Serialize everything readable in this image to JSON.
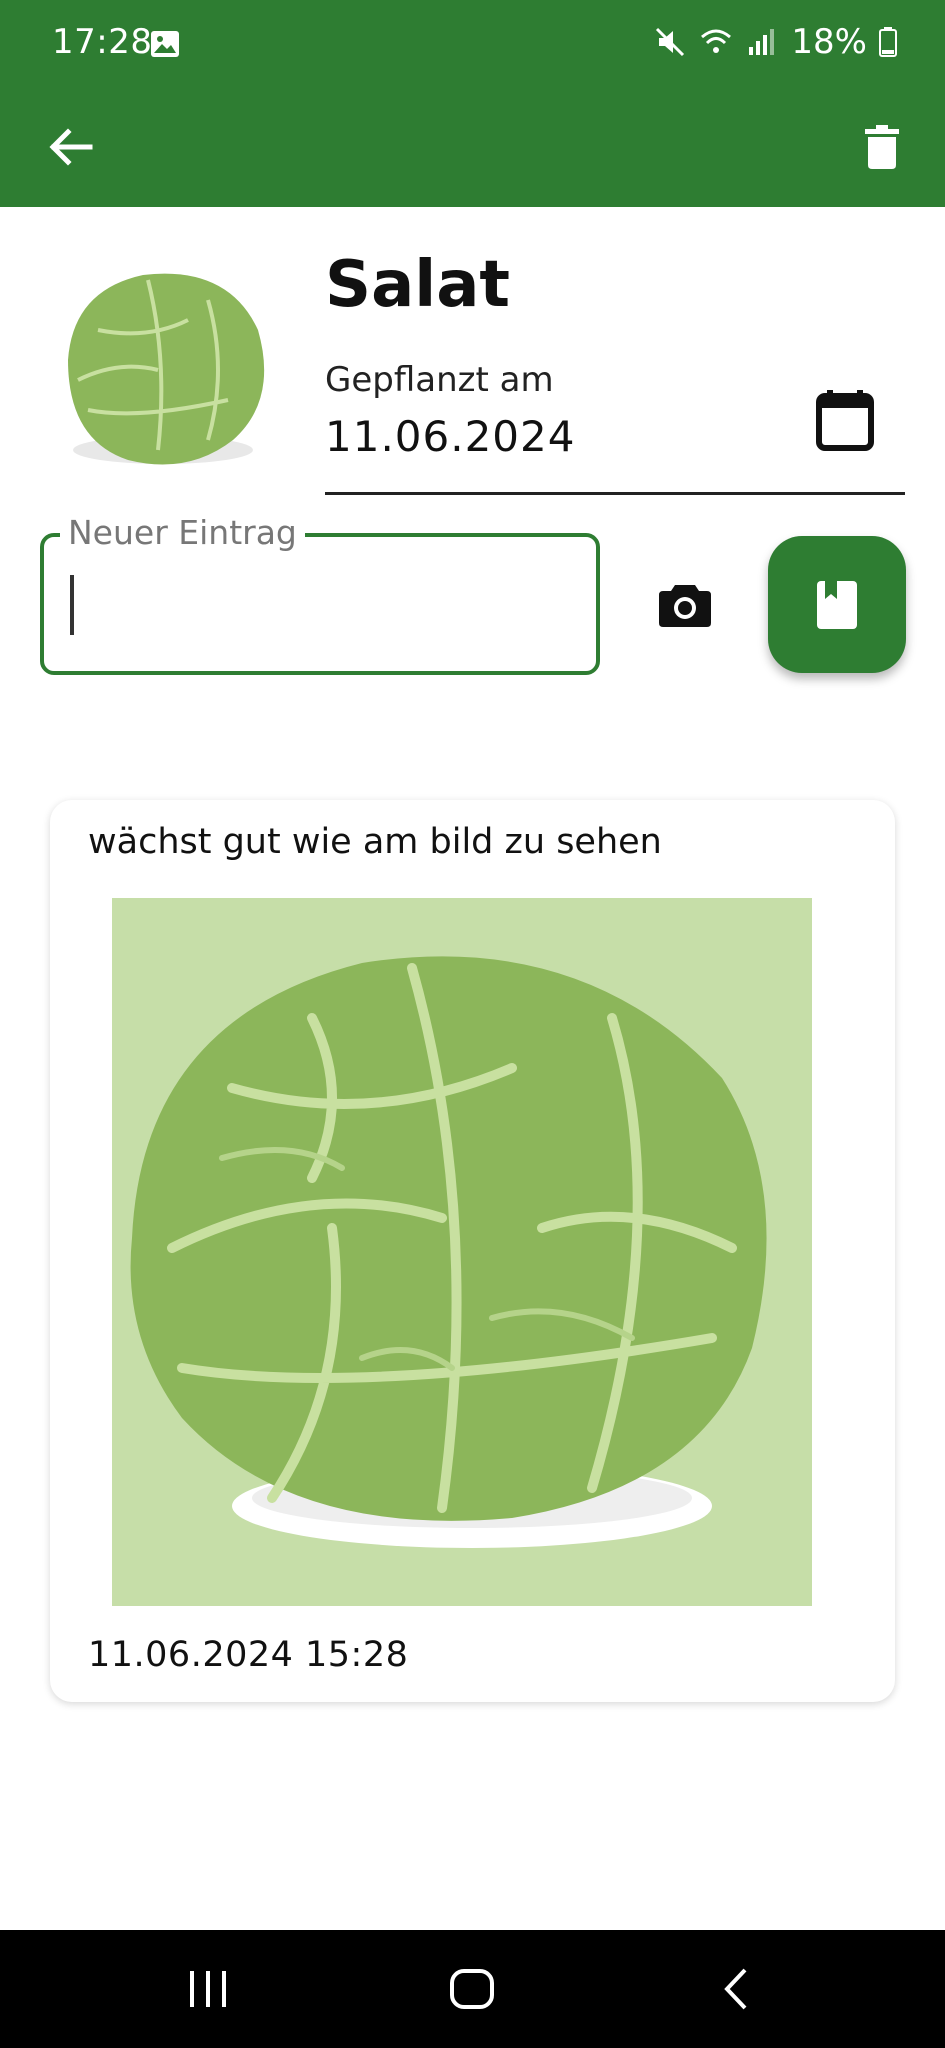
{
  "status_bar": {
    "time": "17:28",
    "battery": "18%",
    "icons": [
      "image-icon",
      "mute-icon",
      "wifi-icon",
      "signal-icon",
      "battery-icon"
    ]
  },
  "app_bar": {
    "back_icon": "arrow-back-icon",
    "delete_icon": "trash-icon",
    "color": "#2e7d32"
  },
  "plant": {
    "name": "Salat",
    "planted_label": "Gepflanzt am",
    "planted_date": "11.06.2024"
  },
  "new_entry": {
    "label": "Neuer Eintrag",
    "value": "",
    "camera_icon": "camera-icon",
    "save_icon": "book-icon"
  },
  "entries": [
    {
      "text": "wächst gut wie am bild zu sehen",
      "timestamp": "11.06.2024 15:28"
    }
  ],
  "nav_bar": {
    "icons": [
      "recent-apps-icon",
      "home-icon",
      "back-icon"
    ]
  },
  "colors": {
    "primary": "#2e7d32",
    "lettuce": "#8cb65a",
    "lettuce_light": "#c6dea8"
  }
}
